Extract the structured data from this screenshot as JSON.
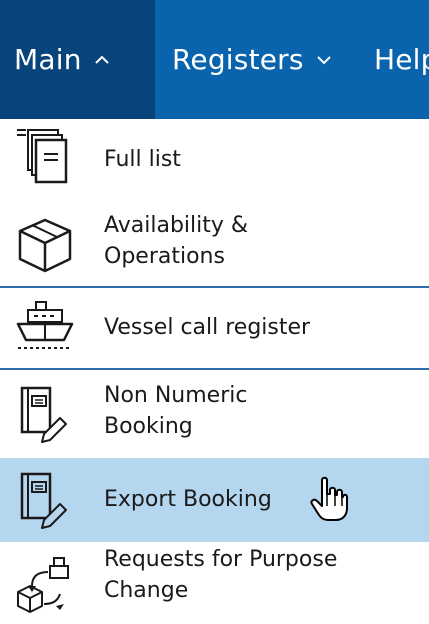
{
  "nav": {
    "main_label": "Main",
    "registers_label": "Registers",
    "help_label": "Help",
    "accent": "#0a64ad",
    "active_bg": "#07447c"
  },
  "menu": {
    "highlight_color": "#b5d6ef",
    "items": [
      {
        "label": "Full list",
        "icon": "document-list-icon"
      },
      {
        "label": "Availability &\nOperations",
        "icon": "package-box-icon"
      },
      {
        "label": "Vessel call register",
        "icon": "ship-icon"
      },
      {
        "label": "Non Numeric\nBooking",
        "icon": "booking-edit-icon"
      },
      {
        "label": "Export Booking",
        "icon": "booking-edit-icon",
        "hovered": true
      },
      {
        "label": "Requests for Purpose\nChange",
        "icon": "purpose-change-icon"
      }
    ]
  }
}
